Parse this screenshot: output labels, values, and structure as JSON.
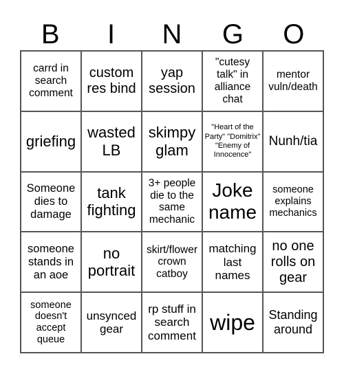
{
  "header": {
    "letters": [
      "B",
      "I",
      "N",
      "G",
      "O"
    ]
  },
  "cells": [
    "carrd in search comment",
    "custom res bind",
    "yap session",
    "\"cutesy talk\" in alliance chat",
    "mentor vuln/death",
    "griefing",
    "wasted LB",
    "skimpy glam",
    "\"Heart of the Party\" \"Domitrix\" \"Enemy of Innocence\"",
    "Nunh/tia",
    "Someone dies to damage",
    "tank fighting",
    "3+ people die to the same mechanic",
    "Joke name",
    "someone explains mechanics",
    "someone stands in an aoe",
    "no portrait",
    "skirt/flower crown catboy",
    "matching last names",
    "no one rolls on gear",
    "someone doesn't accept queue",
    "unsynced gear",
    "rp stuff in search comment",
    "wipe",
    "Standing around"
  ]
}
